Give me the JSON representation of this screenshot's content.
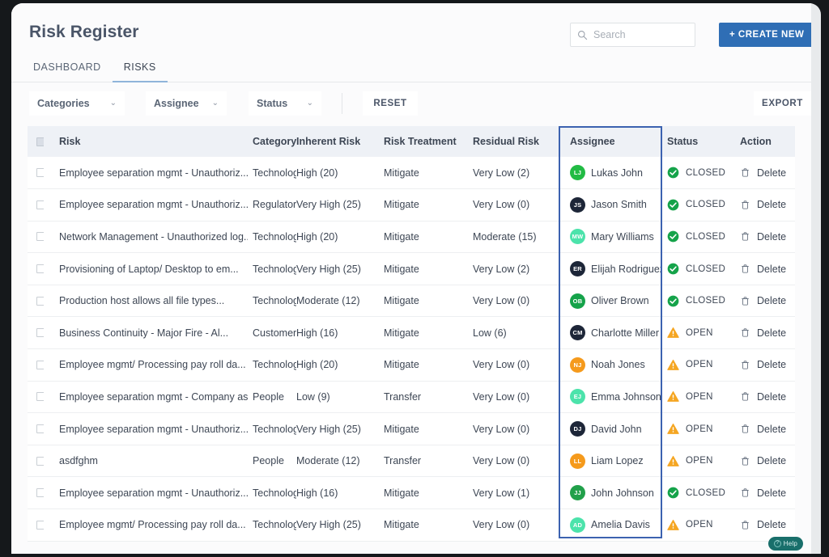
{
  "header": {
    "title": "Risk Register",
    "search": {
      "value": "",
      "placeholder": "Search"
    },
    "create_new_label": "+ CREATE NEW"
  },
  "tabs": [
    {
      "label": "DASHBOARD",
      "active": false
    },
    {
      "label": "RISKS",
      "active": true
    }
  ],
  "filters": {
    "categories": {
      "label": "Categories",
      "chevron": "⌄"
    },
    "assignee": {
      "label": "Assignee",
      "chevron": "⌄"
    },
    "status": {
      "label": "Status",
      "chevron": "⌄"
    },
    "reset_label": "RESET",
    "export_label": "EXPORT"
  },
  "table": {
    "highlighted_column": "Assignee",
    "columns": [
      "Risk",
      "Category",
      "Inherent Risk",
      "Risk Treatment",
      "Residual Risk",
      "Assignee",
      "Status",
      "Action"
    ],
    "action_label": "Delete",
    "rows": [
      {
        "risk": "Employee separation mgmt - Unauthoriz...",
        "category": "Technology",
        "inherent": "High (20)",
        "inherent_sev": "high",
        "treatment": "Mitigate",
        "residual": "Very Low (2)",
        "residual_sev": "verylow",
        "assignee": "Lukas John",
        "initials": "LJ",
        "avatar_color": "#22bb44",
        "status": "CLOSED",
        "status_type": "closed"
      },
      {
        "risk": "Employee separation mgmt - Unauthoriz...",
        "category": "Regulatory",
        "inherent": "Very High (25)",
        "inherent_sev": "veryhigh",
        "treatment": "Mitigate",
        "residual": "Very Low (0)",
        "residual_sev": "verylow",
        "assignee": "Jason Smith",
        "initials": "JS",
        "avatar_color": "#1d2638",
        "status": "CLOSED",
        "status_type": "closed"
      },
      {
        "risk": "Network Management - Unauthorized log...",
        "category": "Technology",
        "inherent": "High (20)",
        "inherent_sev": "high",
        "treatment": "Mitigate",
        "residual": "Moderate (15)",
        "residual_sev": "moderate",
        "assignee": "Mary Williams",
        "initials": "MW",
        "avatar_color": "#4ce3ab",
        "status": "CLOSED",
        "status_type": "closed"
      },
      {
        "risk": "Provisioning of Laptop/ Desktop to em...",
        "category": "Technology",
        "inherent": "Very High (25)",
        "inherent_sev": "veryhigh",
        "treatment": "Mitigate",
        "residual": "Very Low (2)",
        "residual_sev": "verylow",
        "assignee": "Elijah Rodriguez",
        "initials": "ER",
        "avatar_color": "#1d2638",
        "status": "CLOSED",
        "status_type": "closed"
      },
      {
        "risk": "Production host allows all file types...",
        "category": "Technology",
        "inherent": "Moderate (12)",
        "inherent_sev": "moderate",
        "treatment": "Mitigate",
        "residual": "Very Low (0)",
        "residual_sev": "verylow",
        "assignee": "Oliver Brown",
        "initials": "OB",
        "avatar_color": "#15a34a",
        "status": "CLOSED",
        "status_type": "closed"
      },
      {
        "risk": "Business Continuity - Major Fire - Al...",
        "category": "Customer",
        "inherent": "High (16)",
        "inherent_sev": "high",
        "treatment": "Mitigate",
        "residual": "Low (6)",
        "residual_sev": "low",
        "assignee": "Charlotte Miller",
        "initials": "CM",
        "avatar_color": "#1d2638",
        "status": "OPEN",
        "status_type": "open"
      },
      {
        "risk": "Employee mgmt/ Processing pay roll da...",
        "category": "Technology",
        "inherent": "High (20)",
        "inherent_sev": "high",
        "treatment": "Mitigate",
        "residual": "Very Low (0)",
        "residual_sev": "verylow",
        "assignee": "Noah Jones",
        "initials": "NJ",
        "avatar_color": "#f59a1c",
        "status": "OPEN",
        "status_type": "open"
      },
      {
        "risk": "Employee separation mgmt - Company as...",
        "category": "People",
        "inherent": "Low (9)",
        "inherent_sev": "low",
        "treatment": "Transfer",
        "residual": "Very Low (0)",
        "residual_sev": "verylow",
        "assignee": "Emma Johnson",
        "initials": "EJ",
        "avatar_color": "#4ce3ab",
        "status": "OPEN",
        "status_type": "open"
      },
      {
        "risk": "Employee separation mgmt - Unauthoriz...",
        "category": "Technology",
        "inherent": "Very High (25)",
        "inherent_sev": "veryhigh",
        "treatment": "Mitigate",
        "residual": "Very Low (0)",
        "residual_sev": "verylow",
        "assignee": "David John",
        "initials": "DJ",
        "avatar_color": "#1d2638",
        "status": "OPEN",
        "status_type": "open"
      },
      {
        "risk": "asdfghm",
        "category": "People",
        "inherent": "Moderate (12)",
        "inherent_sev": "moderate",
        "treatment": "Transfer",
        "residual": "Very Low (0)",
        "residual_sev": "verylow",
        "assignee": "Liam Lopez",
        "initials": "LL",
        "avatar_color": "#f59a1c",
        "status": "OPEN",
        "status_type": "open"
      },
      {
        "risk": "Employee separation mgmt - Unauthoriz...",
        "category": "Technology",
        "inherent": "High (16)",
        "inherent_sev": "high",
        "treatment": "Mitigate",
        "residual": "Very Low (1)",
        "residual_sev": "verylow",
        "assignee": "John Johnson",
        "initials": "JJ",
        "avatar_color": "#21a04a",
        "status": "CLOSED",
        "status_type": "closed"
      },
      {
        "risk": "Employee mgmt/ Processing pay roll da...",
        "category": "Technology",
        "inherent": "Very High (25)",
        "inherent_sev": "veryhigh",
        "treatment": "Mitigate",
        "residual": "Very Low (0)",
        "residual_sev": "verylow",
        "assignee": "Amelia Davis",
        "initials": "AD",
        "avatar_color": "#4ce3ab",
        "status": "OPEN",
        "status_type": "open"
      }
    ]
  },
  "help": {
    "label": "Help",
    "icon_glyph": "?"
  },
  "colors": {
    "accent": "#2f6eb5",
    "highlight_border": "#3c62b0",
    "very_high": "#f0302c",
    "high": "#f58b7c",
    "moderate": "#f3a325",
    "low": "#14a248",
    "very_low": "#52d878",
    "closed": "#15a34a",
    "open": "#f5a623",
    "help_pill": "#196f6b"
  }
}
